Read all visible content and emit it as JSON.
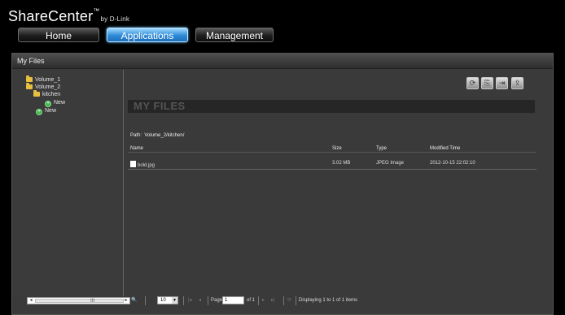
{
  "brand": {
    "name": "ShareCenter",
    "tm": "™",
    "by": "by D-Link"
  },
  "nav": [
    {
      "label": "Home"
    },
    {
      "label": "Applications"
    },
    {
      "label": "Management"
    }
  ],
  "panel": {
    "title": "My Files"
  },
  "tree": {
    "volume1": "Volume_1",
    "volume2": "Volume_2",
    "kitchen": "kitchen",
    "new_sub": "New",
    "new_root": "New"
  },
  "toolbar": {
    "icons": [
      "refresh-icon",
      "copy-icon",
      "move-icon",
      "upload-icon"
    ]
  },
  "files": {
    "heading": "MY FILES",
    "path_label": "Path:",
    "path_value": "Volume_2/kitchen/",
    "columns": {
      "name": "Name",
      "size": "Size",
      "type": "Type",
      "modified": "Modified Time"
    },
    "rows": [
      {
        "name": "bold.jpg",
        "size": "3.02 MB",
        "type": "JPEG Image",
        "modified": "2012-10-15 22:02:10"
      }
    ]
  },
  "pager": {
    "page_size": "10",
    "page_label": "Page",
    "page_value": "1",
    "of_label": "of 1",
    "status": "Displaying 1 to 1 of 1 items",
    "scroll_grip": "III"
  }
}
